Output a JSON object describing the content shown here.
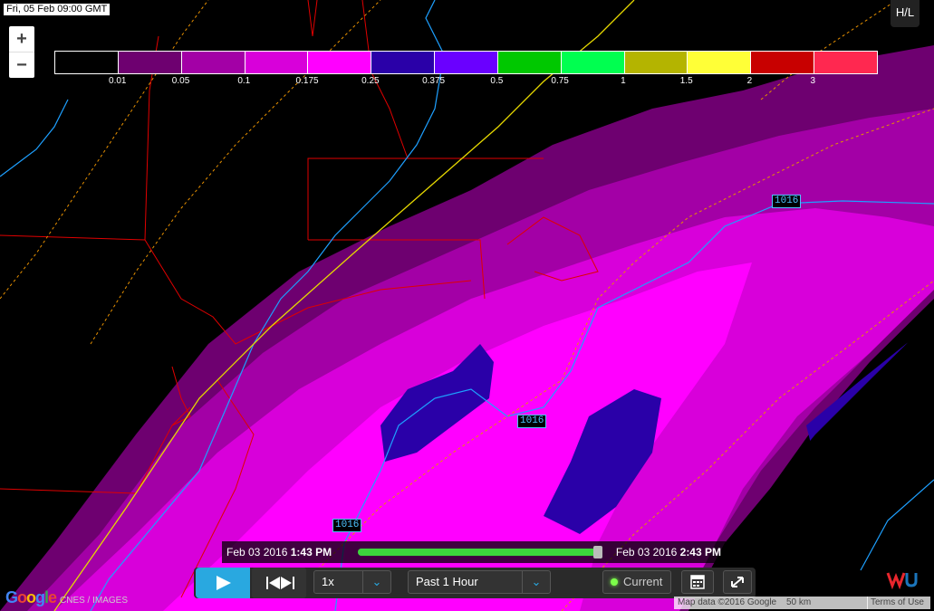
{
  "timestamp": "Fri, 05 Feb  09:00 GMT",
  "zoom": {
    "in_label": "+",
    "out_label": "−"
  },
  "legend": {
    "colors": [
      "#000000",
      "#6e0070",
      "#a300a6",
      "#d800da",
      "#ff00ff",
      "#2a00a8",
      "#6a00ff",
      "#00c800",
      "#00ff50",
      "#b4b400",
      "#ffff37",
      "#c80000",
      "#ff2850"
    ],
    "ticks": [
      "0.01",
      "0.05",
      "0.1",
      "0.175",
      "0.25",
      "0.375",
      "0.5",
      "0.75",
      "1",
      "1.5",
      "2",
      "3"
    ]
  },
  "hl_button": "H/L",
  "isobar_labels": [
    "1016",
    "1016",
    "1016"
  ],
  "timeline": {
    "start_date": "Feb 03 2016",
    "start_time": "1:43 PM",
    "end_date": "Feb 03 2016",
    "end_time": "2:43 PM",
    "progress": 1.0
  },
  "controls": {
    "speed": "1x",
    "range": "Past 1 Hour",
    "current": "Current"
  },
  "google_logo": "Google",
  "attribution": "CNES / IMAGES",
  "footer": {
    "map_data": "Map data ©2016 Google",
    "scale": "50 km",
    "terms": "Terms of Use"
  },
  "icons": {
    "play": "play-icon",
    "step": "step-icon",
    "calendar": "calendar-icon",
    "expand": "expand-icon",
    "wu": "wu-logo-icon"
  }
}
